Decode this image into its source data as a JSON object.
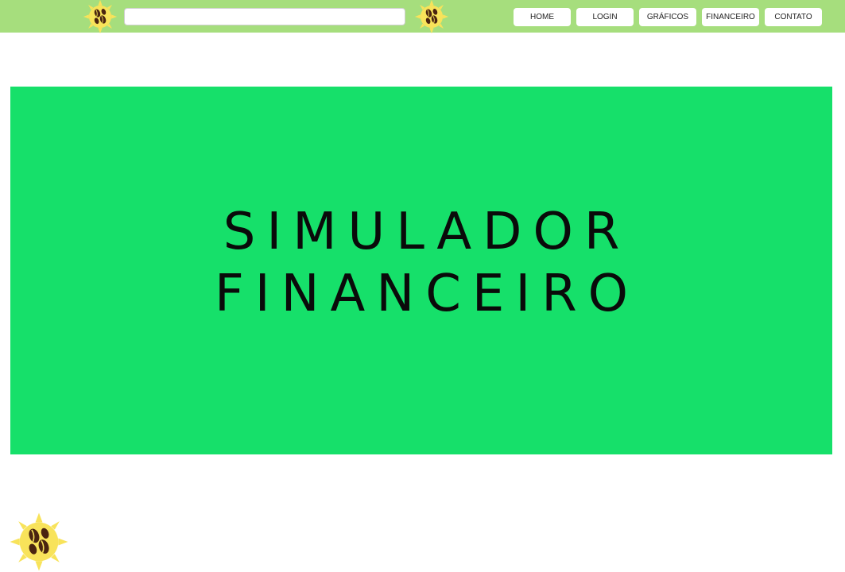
{
  "header": {
    "logo_left_icon": "sun-coffee-logo-icon",
    "logo_right_icon": "sun-coffee-logo-icon",
    "search": {
      "value": "",
      "placeholder": ""
    },
    "nav": [
      {
        "label": "HOME"
      },
      {
        "label": "LOGIN"
      },
      {
        "label": "GRÁFICOS"
      },
      {
        "label": "FINANCEIRO"
      },
      {
        "label": "CONTATO"
      }
    ]
  },
  "hero": {
    "title_line1": "SIMULADOR",
    "title_line2": "FINANCEIRO"
  },
  "footer": {
    "logo_icon": "sun-coffee-logo-icon"
  },
  "colors": {
    "topbar": "#a6de7d",
    "hero": "#16e06a",
    "sun": "#f8e35a",
    "bean": "#4a2410"
  }
}
